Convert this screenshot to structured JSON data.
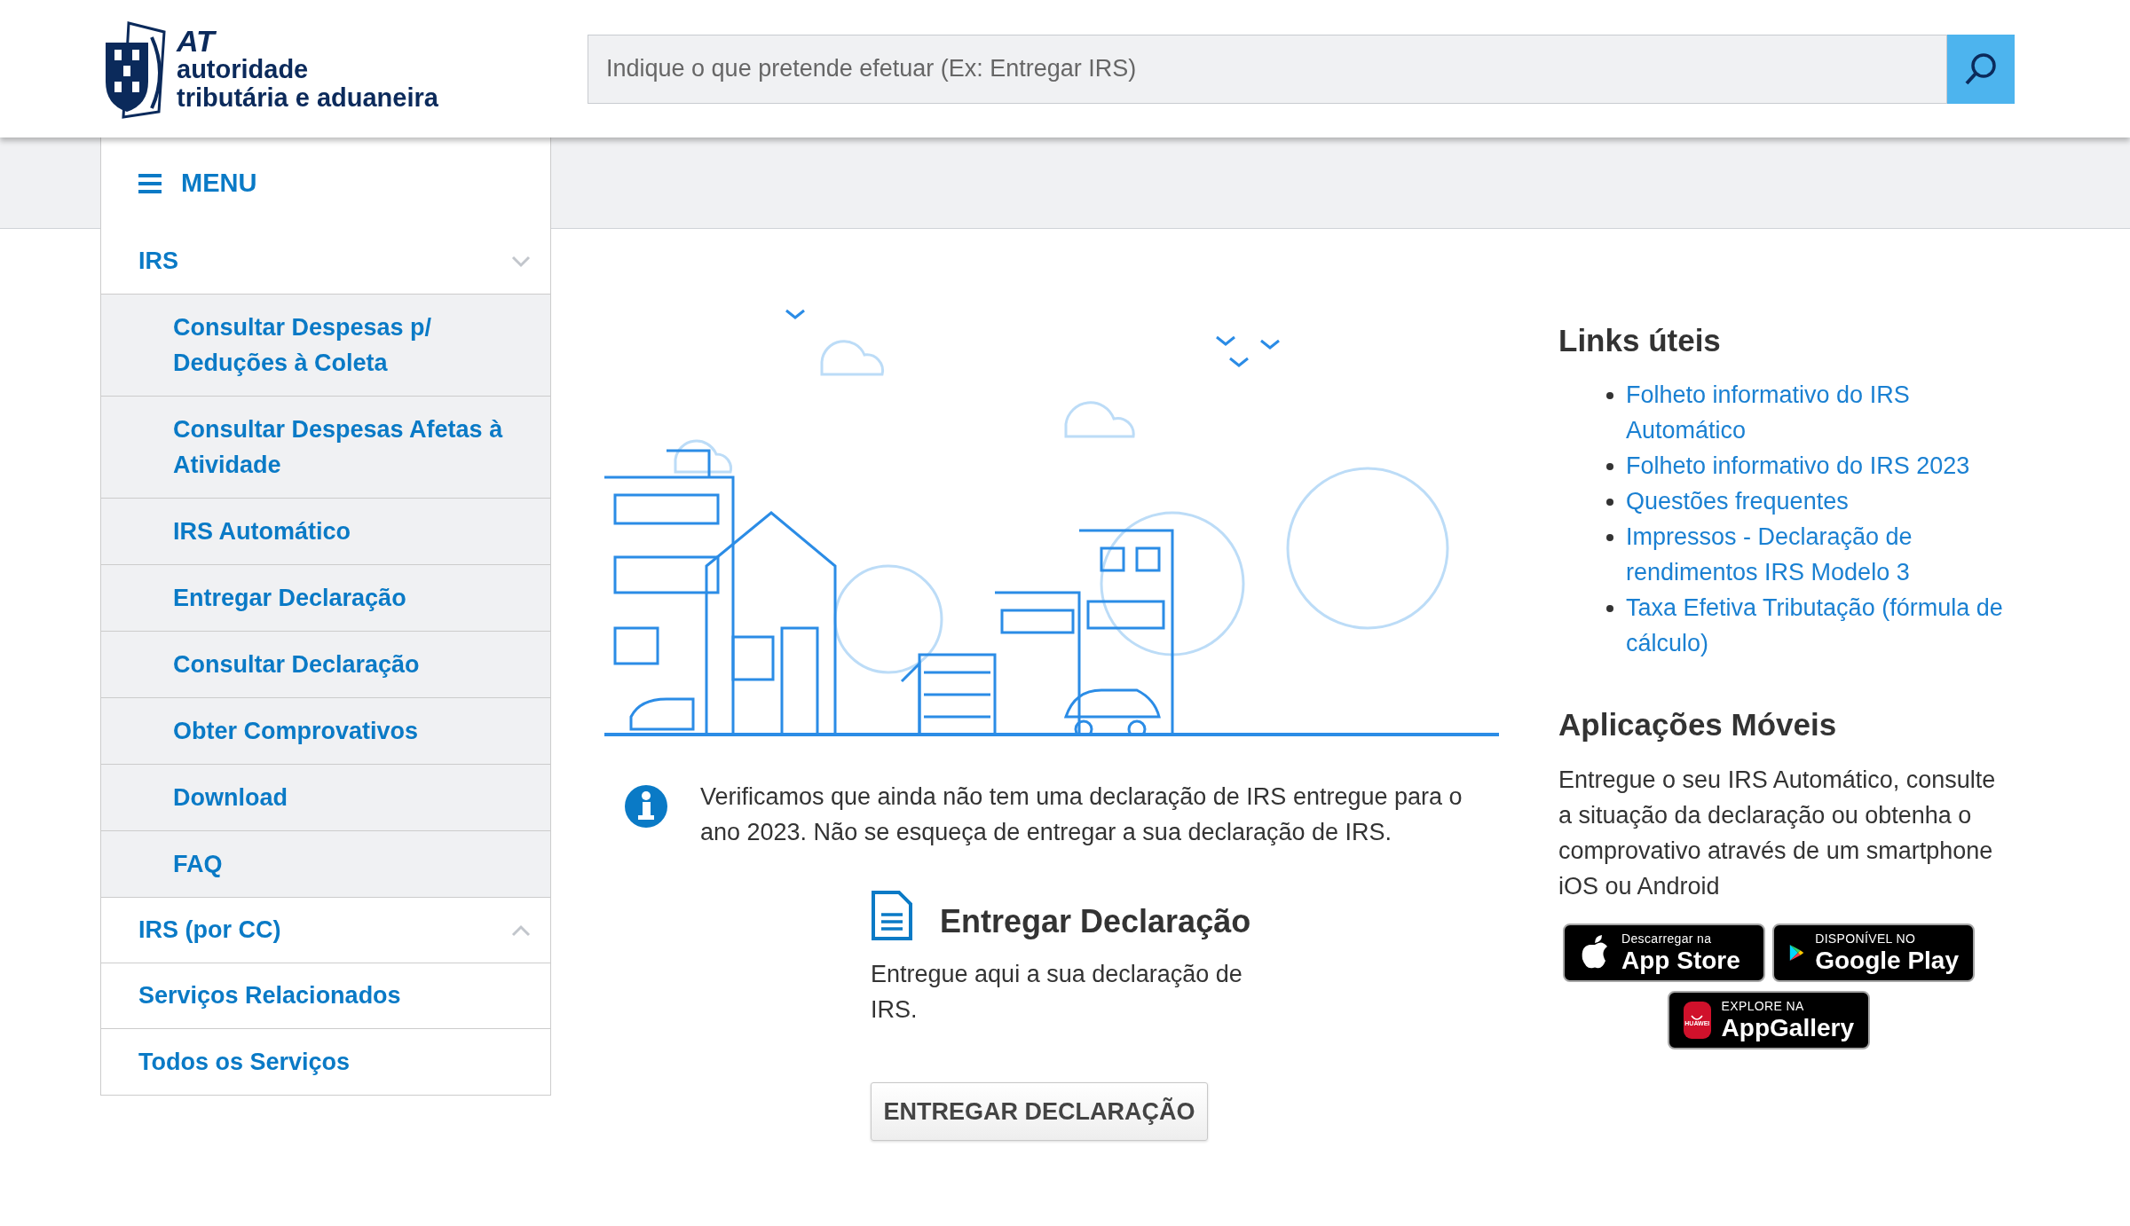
{
  "header": {
    "logo": {
      "abbr": "AT",
      "line1": "autoridade",
      "line2": "tributária e aduaneira"
    },
    "search": {
      "placeholder": "Indique o que pretende efetuar (Ex: Entregar IRS)"
    }
  },
  "menu": {
    "label": "MENU"
  },
  "sidebar": {
    "items": [
      {
        "kind": "group",
        "label": "IRS",
        "expanded": true,
        "children": [
          {
            "label": "Consultar Despesas p/ Deduções à Coleta"
          },
          {
            "label": "Consultar Despesas Afetas à Atividade"
          },
          {
            "label": "IRS Automático"
          },
          {
            "label": "Entregar Declaração"
          },
          {
            "label": "Consultar Declaração"
          },
          {
            "label": "Obter Comprovativos"
          },
          {
            "label": "Download"
          },
          {
            "label": "FAQ"
          }
        ]
      },
      {
        "kind": "group",
        "label": "IRS (por CC)",
        "expanded": false
      },
      {
        "kind": "link",
        "label": "Serviços Relacionados"
      },
      {
        "kind": "link",
        "label": "Todos os Serviços"
      }
    ]
  },
  "main": {
    "notice": "Verificamos que ainda não tem uma declaração de IRS entregue para o ano 2023. Não se esqueça de entregar a sua declaração de IRS.",
    "card": {
      "title": "Entregar Declaração",
      "description": "Entregue aqui a sua declaração de IRS.",
      "button": "ENTREGAR DECLARAÇÃO"
    }
  },
  "aside": {
    "links_title": "Links úteis",
    "links": [
      "Folheto informativo do IRS Automático",
      "Folheto informativo do IRS 2023",
      "Questões frequentes",
      "Impressos - Declaração de rendimentos IRS Modelo 3",
      "Taxa Efetiva Tributação (fórmula de cálculo)"
    ],
    "apps_title": "Aplicações Móveis",
    "apps_text": "Entregue o seu IRS Automático, consulte a situação da declaração ou obtenha o comprovativo através de um smartphone iOS ou Android",
    "badges": [
      {
        "kind": "apple",
        "small": "Descarregar na",
        "big": "App Store"
      },
      {
        "kind": "google",
        "small": "DISPONÍVEL NO",
        "big": "Google Play"
      },
      {
        "kind": "huawei",
        "small": "EXPLORE NA",
        "big": "AppGallery",
        "brand": "HUAWEI"
      }
    ]
  }
}
